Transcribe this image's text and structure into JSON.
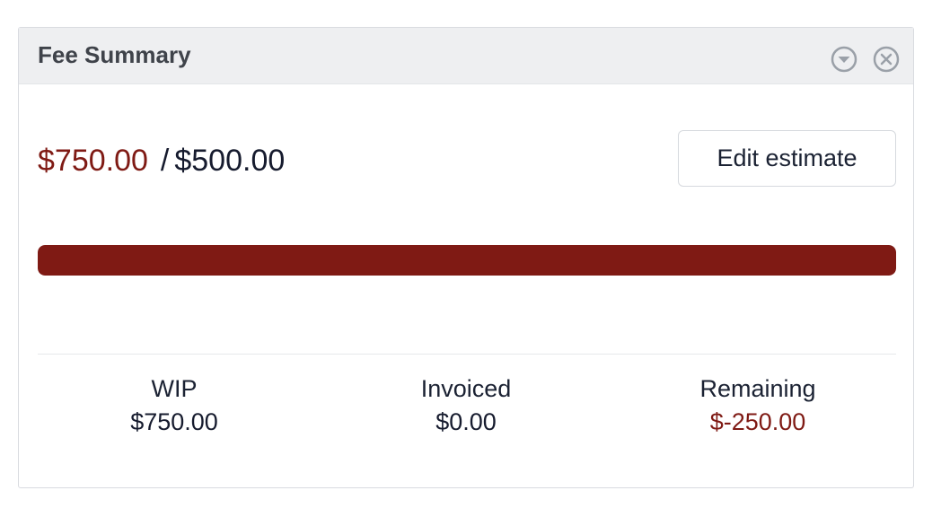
{
  "panel": {
    "title": "Fee Summary",
    "icons": {
      "collapse": "chevron-down-circle-icon",
      "close": "close-circle-icon"
    }
  },
  "summary": {
    "spent": "$750.00",
    "separator": "/",
    "estimate": "$500.00",
    "edit_button_label": "Edit estimate",
    "progress_percent": 100
  },
  "stats": [
    {
      "label": "WIP",
      "value": "$750.00"
    },
    {
      "label": "Invoiced",
      "value": "$0.00"
    },
    {
      "label": "Remaining",
      "value": "$-250.00"
    }
  ],
  "colors": {
    "over_budget": "#7f1a14",
    "header_bg": "#eeeff1",
    "text_dark": "#161b2e"
  }
}
